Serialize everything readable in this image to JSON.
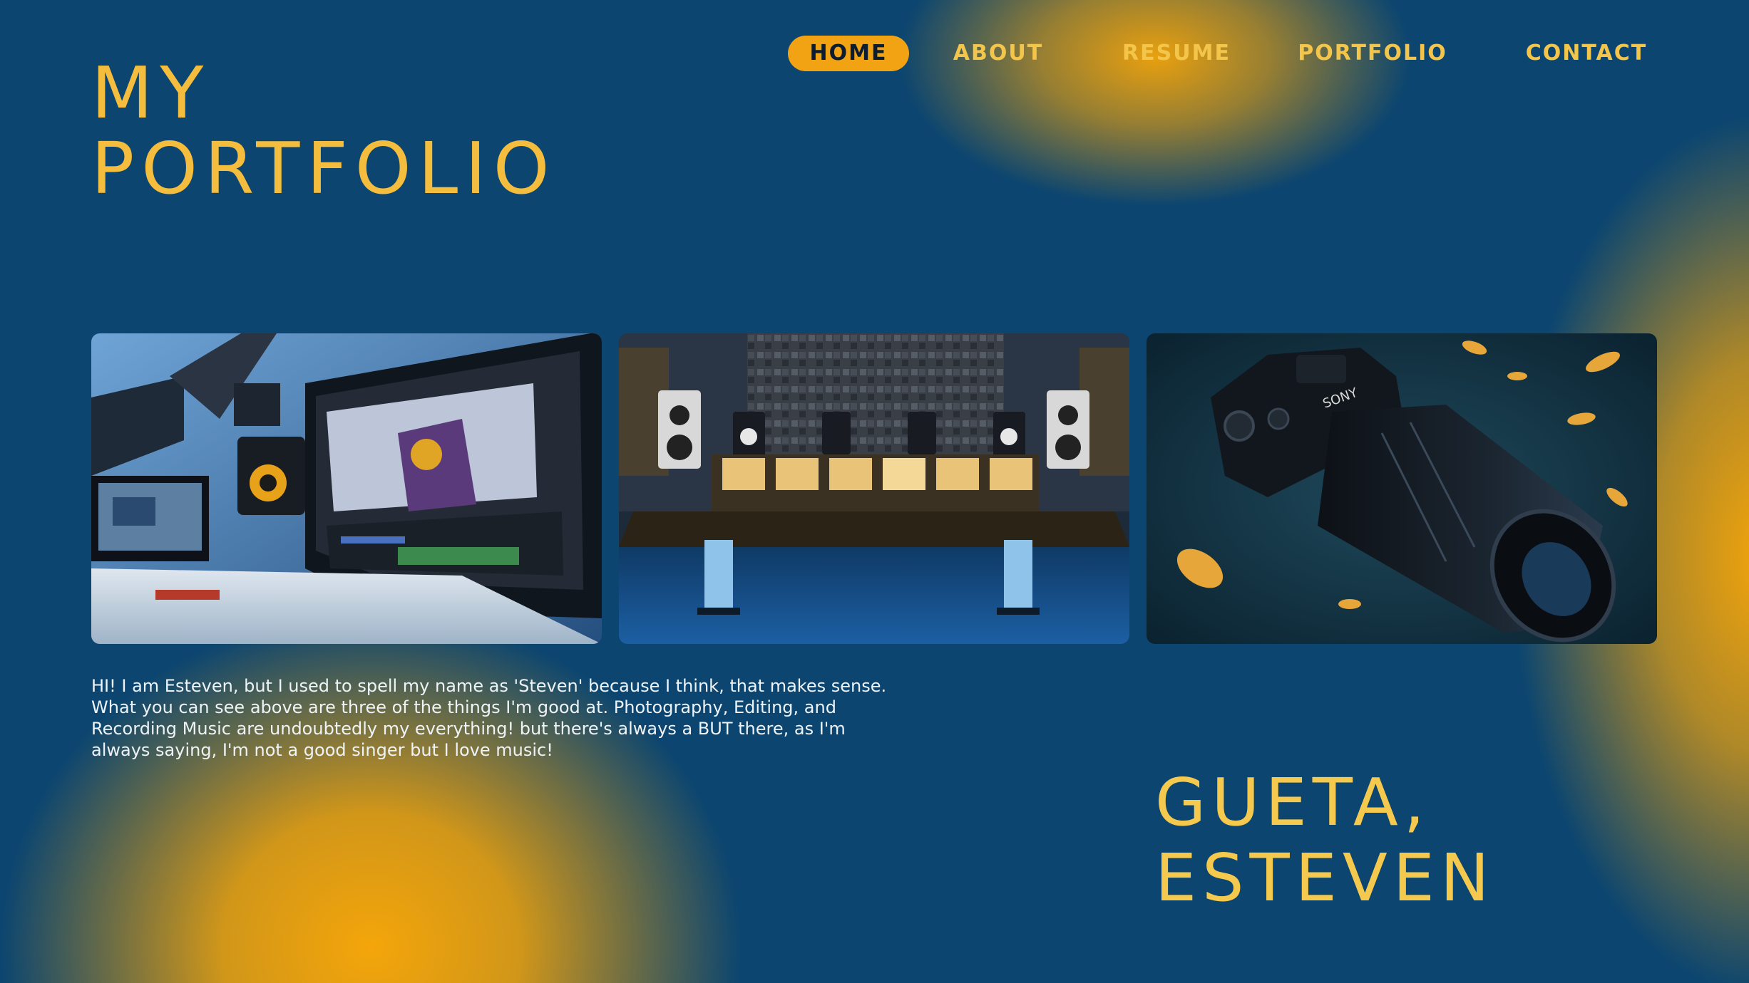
{
  "nav": {
    "items": [
      {
        "label": "HOME",
        "active": true
      },
      {
        "label": "ABOUT",
        "active": false
      },
      {
        "label": "RESUME",
        "active": false
      },
      {
        "label": "PORTFOLIO",
        "active": false
      },
      {
        "label": "CONTACT",
        "active": false
      }
    ]
  },
  "header": {
    "title_line1": "MY",
    "title_line2": "PORTFOLIO"
  },
  "gallery": {
    "images": [
      {
        "subject": "video-editing-workstation"
      },
      {
        "subject": "recording-studio-mixing-console"
      },
      {
        "subject": "sony-camera"
      }
    ]
  },
  "intro": {
    "text": "HI! I am Esteven, but I used to spell my name as 'Steven' because I think, that makes sense. What you can see above are three of the things I'm good at. Photography, Editing, and Recording Music are undoubtedly my everything! but there's always a BUT there, as I'm always saying, I'm not a good singer but I love music!"
  },
  "name": {
    "line1": "GUETA,",
    "line2": "ESTEVEN"
  },
  "colors": {
    "background": "#0b4570",
    "accent": "#f2a313",
    "heading": "#f5bd3d"
  }
}
